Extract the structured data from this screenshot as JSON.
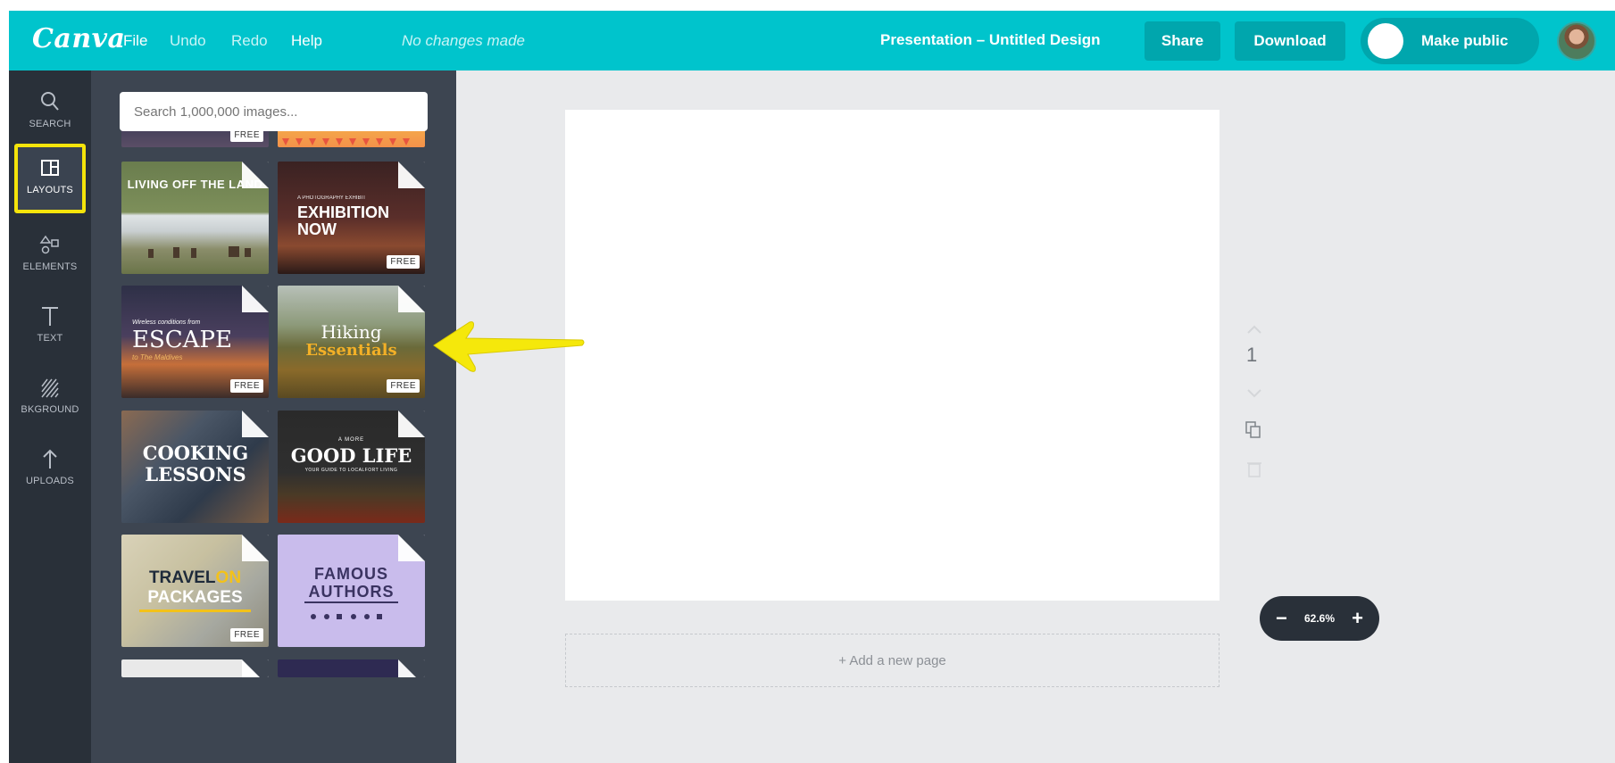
{
  "topbar": {
    "logo": "Canva",
    "menu": [
      "File",
      "Undo",
      "Redo",
      "Help"
    ],
    "status": "No changes made",
    "document_title": "Presentation – Untitled Design",
    "share_label": "Share",
    "download_label": "Download",
    "make_public_label": "Make public"
  },
  "sidebar": {
    "items": [
      {
        "label": "SEARCH",
        "icon": "search-icon"
      },
      {
        "label": "LAYOUTS",
        "icon": "layouts-icon",
        "active": true
      },
      {
        "label": "ELEMENTS",
        "icon": "elements-icon"
      },
      {
        "label": "TEXT",
        "icon": "text-icon"
      },
      {
        "label": "BKGROUND",
        "icon": "background-icon"
      },
      {
        "label": "UPLOADS",
        "icon": "upload-icon"
      }
    ]
  },
  "panel": {
    "search_placeholder": "Search 1,000,000 images...",
    "free_badge": "FREE",
    "layouts": [
      {
        "title": "LIVING OFF THE LAND"
      },
      {
        "kicker": "A PHOTOGRAPHY EXHIBIT",
        "title": "EXHIBITION NOW"
      },
      {
        "kicker": "Wireless conditions from",
        "title": "ESCAPE",
        "subtitle": "to The Maldives"
      },
      {
        "title": "Hiking",
        "title2": "Essentials"
      },
      {
        "title": "COOKING LESSONS"
      },
      {
        "kicker": "A MORE",
        "title": "GOOD LIFE",
        "subtitle": "YOUR GUIDE TO LOCALFORT LIVING"
      },
      {
        "title": "TRAVEL",
        "title_accent": "ON",
        "title2": "PACKAGES"
      },
      {
        "title": "FAMOUS",
        "title2": "AUTHORS"
      }
    ]
  },
  "canvas": {
    "page_number": "1",
    "add_page_label": "+ Add a new page",
    "zoom_level": "62.6%",
    "zoom_out_label": "−",
    "zoom_in_label": "+"
  },
  "colors": {
    "topbar": "#00c4cc",
    "rail": "#293039",
    "panel": "#3d4551",
    "highlight": "#f5e40b",
    "workspace": "#e9eaec"
  }
}
